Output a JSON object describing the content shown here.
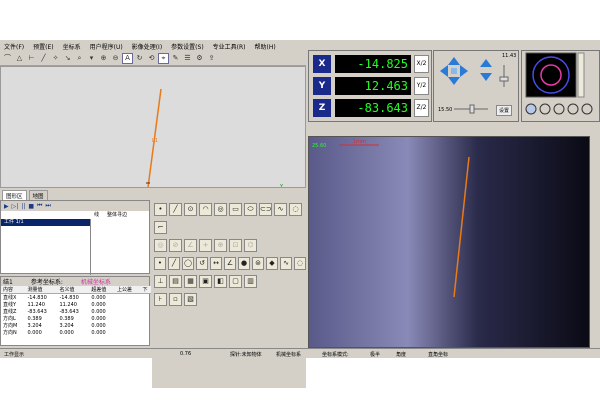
{
  "menu": [
    "文件(F)",
    "预置(E)",
    "坐标系",
    "用户程序(U)",
    "影像处理(I)",
    "参数设置(S)",
    "专业工具(R)",
    "帮助(H)"
  ],
  "toolbar_icons": [
    "arc-tool-icon",
    "triangle-icon",
    "span-icon",
    "line-icon",
    "magic-icon",
    "measure-icon",
    "probe-icon",
    "more-icon",
    "zoom-in-icon",
    "zoom-out-icon",
    "text-icon",
    "refresh-icon",
    "rotate-icon",
    "crosshair-icon",
    "edit-icon",
    "list-icon",
    "settings-icon",
    "export-icon"
  ],
  "tabs": [
    "图形区",
    "地图"
  ],
  "program": {
    "selected_item": "工件  1/1",
    "col_a": "线",
    "col_b": "整体寻边"
  },
  "results": {
    "title": "结1",
    "coord_label": "参考坐标系:",
    "coord_value": "机械坐标系",
    "headers": [
      "内容",
      "测量值",
      "名义值",
      "超差值",
      "上公差",
      "下"
    ],
    "rows": [
      [
        "直线X",
        "-14.830",
        "-14.830",
        "0.000"
      ],
      [
        "直线Y",
        "11.240",
        "11.240",
        "0.000"
      ],
      [
        "直线Z",
        "-83.643",
        "-83.643",
        "0.000"
      ],
      [
        "方向L",
        "0.389",
        "0.389",
        "0.000"
      ],
      [
        "方向M",
        "3.204",
        "3.204",
        "0.000"
      ],
      [
        "方向N",
        "0.000",
        "0.000",
        "0.000"
      ]
    ]
  },
  "dro": {
    "x_label": "X",
    "x_value": "-14.825",
    "y_label": "Y",
    "y_value": "12.463",
    "z_label": "Z",
    "z_value": "-83.643",
    "x_half": "X/2",
    "y_half": "Y/2",
    "z_half": "Z/2"
  },
  "motion": {
    "speed_top": "11.43",
    "speed_left": "15.50",
    "settings_label": "设置"
  },
  "camera": {
    "readout": "25.60",
    "scale_label": "1mm"
  },
  "statusbar": {
    "left": "工作显示",
    "zoom": "0.76",
    "probe": "探针:未知物体",
    "coord_sys": "机械坐标系",
    "coord_mode": "坐标系模式:",
    "mode_val": "极半",
    "angle": "角度",
    "rect": "直角坐标"
  },
  "colors": {
    "line": "#e87a1a",
    "dro_bg": "#000000",
    "dro_text": "#22ff22",
    "axis_label_bg": "#1a2a8a"
  }
}
